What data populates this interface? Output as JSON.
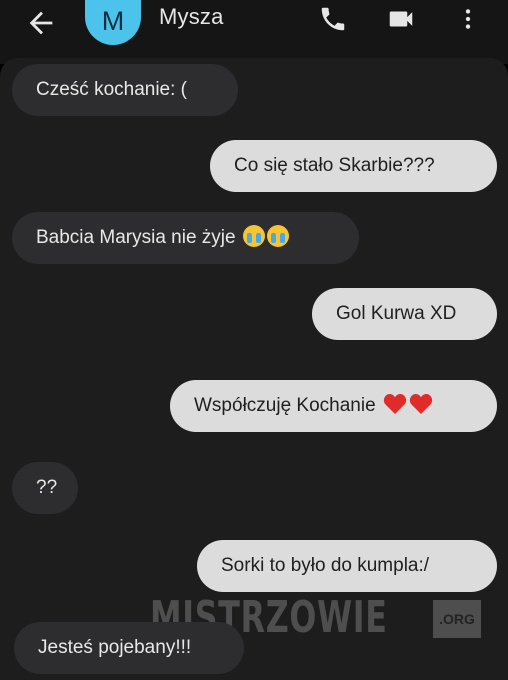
{
  "header": {
    "avatar_letter": "M",
    "contact_name": "Mysza",
    "icons": [
      "back-arrow-icon",
      "phone-icon",
      "video-camera-icon",
      "more-vertical-icon"
    ]
  },
  "messages": [
    {
      "direction": "incoming",
      "text": "Cześć kochanie: ("
    },
    {
      "direction": "outgoing",
      "text": "Co się stało Skarbie???"
    },
    {
      "direction": "incoming",
      "text": "Babcia Marysia nie żyje",
      "emoji": [
        "loudly-crying-face",
        "loudly-crying-face"
      ]
    },
    {
      "direction": "outgoing",
      "text": "Gol Kurwa XD"
    },
    {
      "direction": "outgoing",
      "text": "Współczuję Kochanie",
      "emoji": [
        "red-heart",
        "red-heart"
      ]
    },
    {
      "direction": "incoming",
      "text": "??"
    },
    {
      "direction": "outgoing",
      "text": "Sorki to było do kumpla:/"
    },
    {
      "direction": "incoming",
      "text": "Jesteś pojebany!!!"
    }
  ],
  "watermark": {
    "text": "MISTRZOWIE",
    "suffix": ".ORG"
  },
  "colors": {
    "avatar": "#4cc3ea",
    "incoming_bubble": "#2d2d2f",
    "outgoing_bubble": "#dcdcdc",
    "background": "#1d1d1e"
  }
}
